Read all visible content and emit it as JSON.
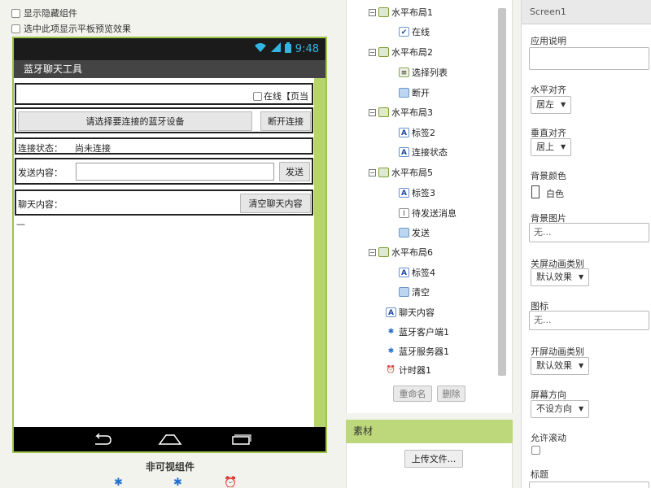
{
  "viewer": {
    "show_hidden_label": "显示隐藏组件",
    "tablet_preview_label": "选中此项显示平板预览效果",
    "status_time": "9:48",
    "app_title": "蓝牙聊天工具",
    "online_checkbox_label": "在线【页当",
    "choose_device_button": "请选择要连接的蓝牙设备",
    "disconnect_button": "断开连接",
    "conn_state_label": "连接状态：",
    "conn_state_value": "尚未连接",
    "send_content_label": "发送内容：",
    "send_button": "发送",
    "chat_content_label": "聊天内容：",
    "clear_chat_button": "清空聊天内容",
    "chat_cursor": "—",
    "nonvisible_title": "非可视组件"
  },
  "tree": {
    "items": [
      {
        "label": "水平布局1",
        "icon": "horizontal-layout-icon"
      },
      {
        "label": "在线",
        "icon": "checkbox-icon"
      },
      {
        "label": "水平布局2",
        "icon": "horizontal-layout-icon"
      },
      {
        "label": "选择列表",
        "icon": "list-picker-icon"
      },
      {
        "label": "断开",
        "icon": "button-icon"
      },
      {
        "label": "水平布局3",
        "icon": "horizontal-layout-icon"
      },
      {
        "label": "标签2",
        "icon": "label-icon"
      },
      {
        "label": "连接状态",
        "icon": "label-icon"
      },
      {
        "label": "水平布局5",
        "icon": "horizontal-layout-icon"
      },
      {
        "label": "标签3",
        "icon": "label-icon"
      },
      {
        "label": "待发送消息",
        "icon": "textbox-icon"
      },
      {
        "label": "发送",
        "icon": "button-icon"
      },
      {
        "label": "水平布局6",
        "icon": "horizontal-layout-icon"
      },
      {
        "label": "标签4",
        "icon": "label-icon"
      },
      {
        "label": "清空",
        "icon": "button-icon"
      },
      {
        "label": "聊天内容",
        "icon": "label-icon"
      },
      {
        "label": "蓝牙客户端1",
        "icon": "bluetooth-icon"
      },
      {
        "label": "蓝牙服务器1",
        "icon": "bluetooth-icon"
      },
      {
        "label": "计时器1",
        "icon": "clock-icon"
      }
    ],
    "rename_button": "重命名",
    "delete_button": "删除"
  },
  "media": {
    "title": "素材",
    "upload_button": "上传文件..."
  },
  "props": {
    "header": "Screen1",
    "about_label": "应用说明",
    "halign_label": "水平对齐",
    "halign_value": "居左",
    "valign_label": "垂直对齐",
    "valign_value": "居上",
    "bgcolor_label": "背景颜色",
    "bgcolor_value": "白色",
    "bgimage_label": "背景图片",
    "bgimage_value": "无...",
    "close_anim_label": "关屏动画类别",
    "close_anim_value": "默认效果",
    "icon_label": "图标",
    "icon_value": "无...",
    "open_anim_label": "开屏动画类别",
    "open_anim_value": "默认效果",
    "orientation_label": "屏幕方向",
    "orientation_value": "不设方向",
    "scrollable_label": "允许滚动",
    "title_label": "标题"
  }
}
